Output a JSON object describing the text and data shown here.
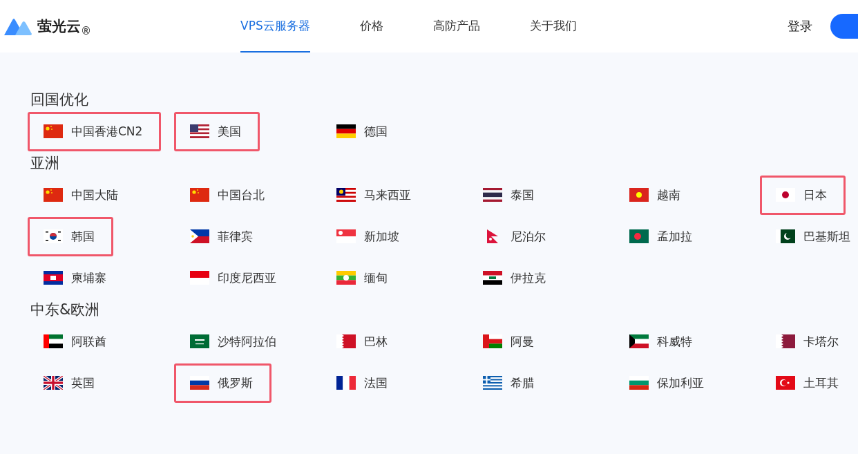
{
  "header": {
    "logo": {
      "name": "萤光云",
      "mark": "®"
    },
    "nav": [
      {
        "label": "VPS云服务器",
        "selected": true
      },
      {
        "label": "价格",
        "selected": false
      },
      {
        "label": "高防产品",
        "selected": false
      },
      {
        "label": "关于我们",
        "selected": false
      }
    ],
    "login": "登录"
  },
  "sections": [
    {
      "title": "回国优化",
      "items": [
        {
          "kind": "cn",
          "name": "中国香港CN2",
          "highlighted": true
        },
        {
          "kind": "us",
          "name": "美国",
          "highlighted": true
        },
        {
          "kind": "de",
          "name": "德国",
          "highlighted": false
        }
      ]
    },
    {
      "title": "亚洲",
      "items": [
        {
          "kind": "cn",
          "name": "中国大陆",
          "highlighted": false
        },
        {
          "kind": "cn",
          "name": "中国台北",
          "highlighted": false
        },
        {
          "kind": "my",
          "name": "马来西亚",
          "highlighted": false
        },
        {
          "kind": "th",
          "name": "泰国",
          "highlighted": false
        },
        {
          "kind": "vn",
          "name": "越南",
          "highlighted": false
        },
        {
          "kind": "jp",
          "name": "日本",
          "highlighted": true
        },
        {
          "kind": "kr",
          "name": "韩国",
          "highlighted": true
        },
        {
          "kind": "ph",
          "name": "菲律宾",
          "highlighted": false
        },
        {
          "kind": "sg",
          "name": "新加坡",
          "highlighted": false
        },
        {
          "kind": "np",
          "name": "尼泊尔",
          "highlighted": false
        },
        {
          "kind": "bd",
          "name": "孟加拉",
          "highlighted": false
        },
        {
          "kind": "pk",
          "name": "巴基斯坦",
          "highlighted": false
        },
        {
          "kind": "kh",
          "name": "柬埔寨",
          "highlighted": false
        },
        {
          "kind": "id",
          "name": "印度尼西亚",
          "highlighted": false
        },
        {
          "kind": "mm",
          "name": "缅甸",
          "highlighted": false
        },
        {
          "kind": "iq",
          "name": "伊拉克",
          "highlighted": false
        }
      ]
    },
    {
      "title": "中东&欧洲",
      "items": [
        {
          "kind": "ae",
          "name": "阿联酋",
          "highlighted": false
        },
        {
          "kind": "sa",
          "name": "沙特阿拉伯",
          "highlighted": false
        },
        {
          "kind": "bh",
          "name": "巴林",
          "highlighted": false
        },
        {
          "kind": "om",
          "name": "阿曼",
          "highlighted": false
        },
        {
          "kind": "kw",
          "name": "科威特",
          "highlighted": false
        },
        {
          "kind": "qa",
          "name": "卡塔尔",
          "highlighted": false
        },
        {
          "kind": "gb",
          "name": "英国",
          "highlighted": false
        },
        {
          "kind": "ru",
          "name": "俄罗斯",
          "highlighted": true
        },
        {
          "kind": "fr",
          "name": "法国",
          "highlighted": false
        },
        {
          "kind": "gr",
          "name": "希腊",
          "highlighted": false
        },
        {
          "kind": "bg",
          "name": "保加利亚",
          "highlighted": false
        },
        {
          "kind": "tr",
          "name": "土耳其",
          "highlighted": false
        }
      ]
    }
  ]
}
